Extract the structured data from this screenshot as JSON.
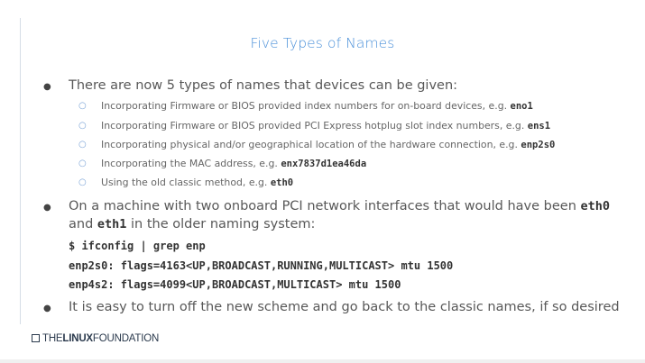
{
  "title": "Five Types of Names",
  "bullets": [
    {
      "text": "There are now 5 types of names that devices can be given:"
    }
  ],
  "subbullets": [
    {
      "text": "Incorporating Firmware or BIOS provided index numbers for on-board devices, e.g. ",
      "code": "eno1"
    },
    {
      "text": "Incorporating Firmware or BIOS provided PCI Express hotplug slot index numbers, e.g. ",
      "code": "ens1"
    },
    {
      "text": "Incorporating physical and/or geographical location of the hardware connection, e.g. ",
      "code": "enp2s0"
    },
    {
      "text": "Incorporating the MAC address, e.g. ",
      "code": "enx7837d1ea46da"
    },
    {
      "text": "Using the old classic method, e.g. ",
      "code": "eth0"
    }
  ],
  "bullet2": {
    "line1_text": "On a machine with two onboard PCI network interfaces that would have been ",
    "line1_code": "eth0",
    "line2_pre": "and ",
    "line2_code": "eth1",
    "line2_text": " in the older naming system:"
  },
  "code_lines": [
    "$ ifconfig | grep enp",
    "enp2s0: flags=4163<UP,BROADCAST,RUNNING,MULTICAST> mtu 1500",
    "enp4s2: flags=4099<UP,BROADCAST,MULTICAST> mtu 1500"
  ],
  "bullet3": "It is easy to turn off the new scheme and go back to the classic names, if so desired",
  "footer": {
    "the": "THE",
    "linux": "LINUX",
    "foundation": "FOUNDATION"
  },
  "colors": {
    "title": "#4a90d9",
    "subbullet_marker": "#7aa3d6",
    "text": "#585858"
  }
}
